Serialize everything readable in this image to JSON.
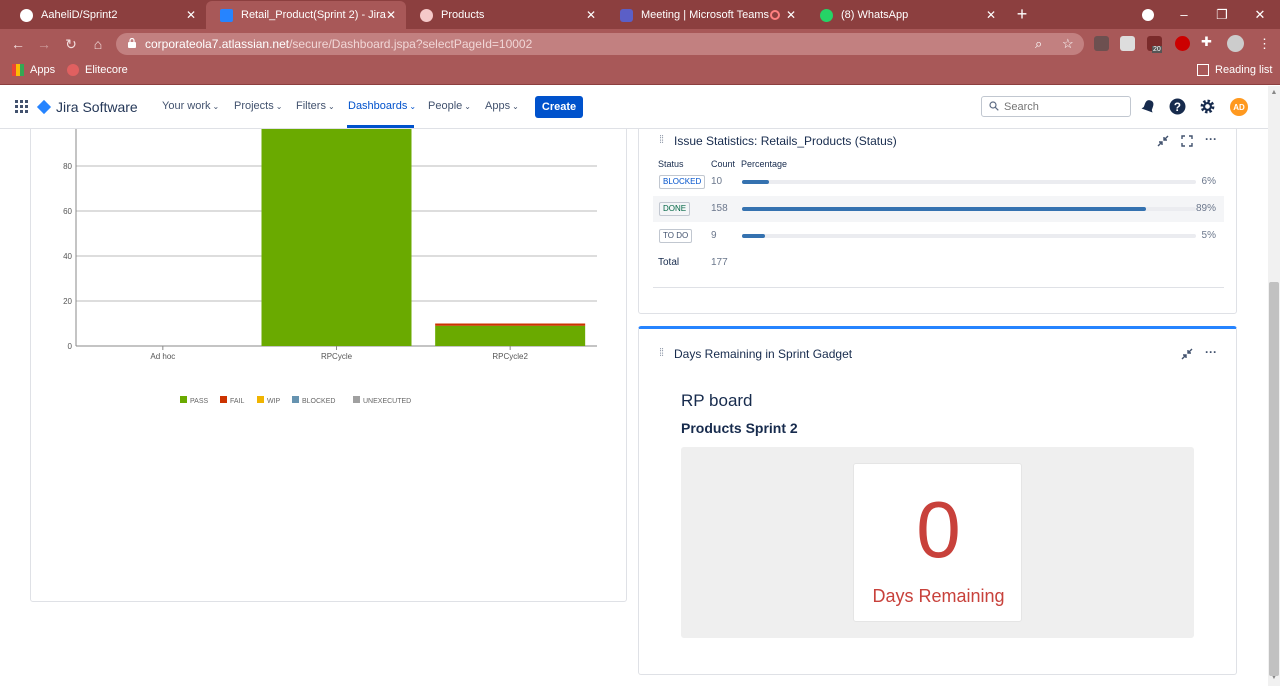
{
  "browser": {
    "tabs": [
      {
        "title": "AaheliD/Sprint2",
        "icon": "github-icon"
      },
      {
        "title": "Retail_Product(Sprint 2) - Jira",
        "icon": "jira-icon",
        "active": true
      },
      {
        "title": "Products",
        "icon": "browser-icon"
      },
      {
        "title": "Meeting | Microsoft Teams",
        "icon": "teams-icon"
      },
      {
        "title": "(8) WhatsApp",
        "icon": "whatsapp-icon"
      }
    ],
    "url_host": "corporateola7.atlassian.net",
    "url_path": "/secure/Dashboard.jspa?selectPageId=10002",
    "extension_badge": "20",
    "bookmarks": [
      {
        "label": "Apps",
        "icon": "apps-grid-icon"
      },
      {
        "label": "Elitecore",
        "icon": "elitecore-icon"
      }
    ],
    "reading_list": "Reading list"
  },
  "jira": {
    "product": "Jira Software",
    "nav": {
      "your_work": "Your work",
      "projects": "Projects",
      "filters": "Filters",
      "dashboards": "Dashboards",
      "people": "People",
      "apps": "Apps"
    },
    "create": "Create",
    "search_placeholder": "Search",
    "avatar": "AD"
  },
  "chart_data": {
    "type": "bar",
    "categories": [
      "Ad hoc",
      "RPCycle",
      "RPCycle2"
    ],
    "series": [
      {
        "name": "PASS",
        "color": "#6aaa00",
        "values": [
          0,
          100,
          9
        ]
      },
      {
        "name": "FAIL",
        "color": "#cc3300",
        "values": [
          0,
          0,
          1
        ]
      },
      {
        "name": "WIP",
        "color": "#f0b400",
        "values": [
          0,
          0,
          0
        ]
      },
      {
        "name": "BLOCKED",
        "color": "#6693b0",
        "values": [
          0,
          0,
          0
        ]
      },
      {
        "name": "UNEXECUTED",
        "color": "#a0a0a0",
        "values": [
          0,
          0,
          0
        ]
      }
    ],
    "yticks": [
      0,
      20,
      40,
      60,
      80
    ],
    "ylim": [
      0,
      100
    ],
    "stacked": true,
    "grid": true,
    "legend": "bottom"
  },
  "issue_stats": {
    "title": "Issue Statistics: Retails_Products (Status)",
    "headers": {
      "status": "Status",
      "count": "Count",
      "percentage": "Percentage"
    },
    "rows": [
      {
        "status": "BLOCKED",
        "count": "10",
        "percent": "6%",
        "fraction": 0.06,
        "color": "#0052cc"
      },
      {
        "status": "DONE",
        "count": "158",
        "percent": "89%",
        "fraction": 0.89,
        "color": "#006644"
      },
      {
        "status": "TO DO",
        "count": "9",
        "percent": "5%",
        "fraction": 0.05,
        "color": "#42526e"
      }
    ],
    "total_label": "Total",
    "total": "177"
  },
  "days_remaining": {
    "title": "Days Remaining in Sprint Gadget",
    "board": "RP board",
    "sprint": "Products Sprint 2",
    "days": "0",
    "label": "Days Remaining"
  }
}
